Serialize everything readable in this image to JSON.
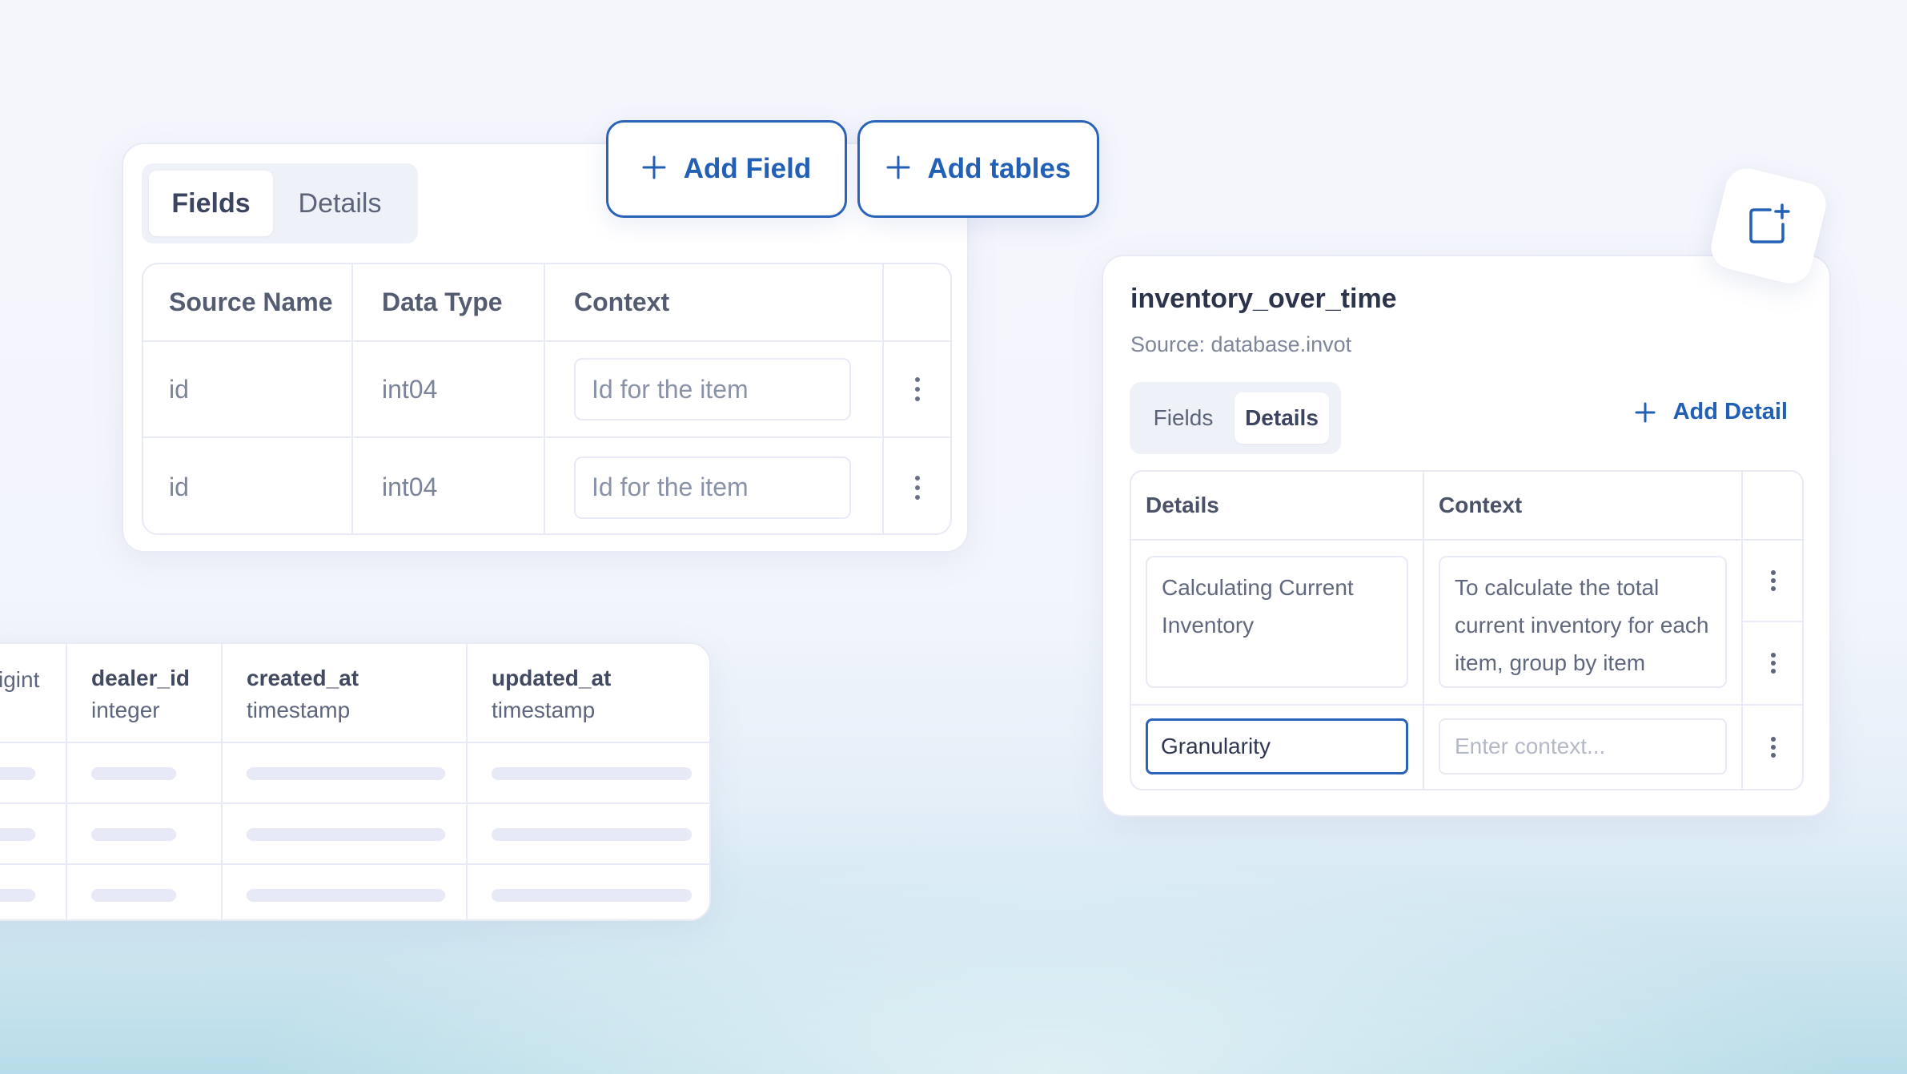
{
  "fields_card": {
    "tabs": [
      "Fields",
      "Details"
    ],
    "active_tab": "Fields",
    "headers": [
      "Source Name",
      "Data Type",
      "Context"
    ],
    "rows": [
      {
        "source_name": "id",
        "data_type": "int04",
        "context_placeholder": "Id for the item"
      },
      {
        "source_name": "id",
        "data_type": "int04",
        "context_placeholder": "Id for the item"
      }
    ],
    "row_menu_icon": "kebab-icon"
  },
  "toolbar": {
    "add_field_label": "Add Field",
    "add_tables_label": "Add tables",
    "plus_icon": "plus-icon"
  },
  "detail_card": {
    "title": "inventory_over_time",
    "source": "Source: database.invot",
    "tabs": [
      "Fields",
      "Details"
    ],
    "active_tab": "Details",
    "add_detail_label": "Add Detail",
    "headers": [
      "Details",
      "Context"
    ],
    "row1": {
      "detail": "Calculating Current Inventory",
      "context": "To calculate the total current inventory for each item, group by item"
    },
    "row2": {
      "detail_value": "Granularity",
      "context_placeholder": "Enter context..."
    },
    "corner_icon": "add-panel-icon"
  },
  "columns_card": {
    "columns": [
      {
        "name": "",
        "type": "igint"
      },
      {
        "name": "dealer_id",
        "type": "integer"
      },
      {
        "name": "created_at",
        "type": "timestamp"
      },
      {
        "name": "updated_at",
        "type": "timestamp"
      }
    ]
  },
  "colors": {
    "accent": "#2b63b8",
    "card_border": "#e8ebf5",
    "skeleton": "#e7eaf6",
    "background_bottom": "#b8dde8"
  }
}
